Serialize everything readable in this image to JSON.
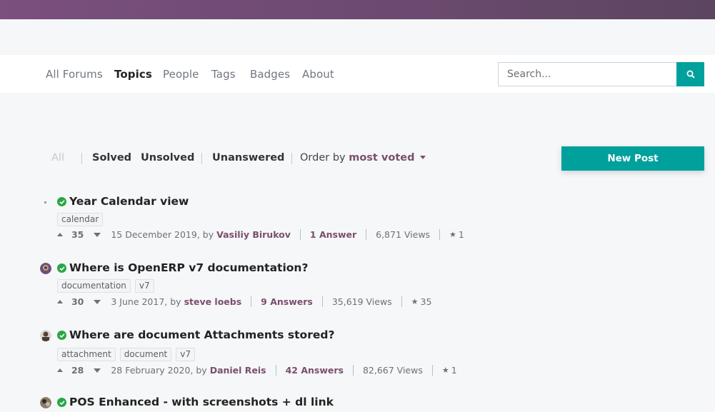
{
  "colors": {
    "topbar": "#7b4f7e",
    "primary": "#00a09d",
    "accent_text": "#7a4f6d",
    "check": "#28a745"
  },
  "nav": {
    "items": [
      {
        "label": "All Forums",
        "active": false
      },
      {
        "label": "Topics",
        "active": true
      },
      {
        "label": "People",
        "active": false
      },
      {
        "label": "Tags",
        "active": false
      },
      {
        "label": "Badges",
        "active": false
      },
      {
        "label": "About",
        "active": false
      }
    ]
  },
  "search": {
    "placeholder": "Search...",
    "icon": "search-icon"
  },
  "filters": {
    "all": "All",
    "solved": "Solved",
    "unsolved": "Unsolved",
    "unanswered": "Unanswered",
    "order_prefix": "Order by",
    "order_value": "most voted"
  },
  "new_post_label": "New Post",
  "posts": [
    {
      "title": "Year Calendar view",
      "tags": [
        "calendar"
      ],
      "votes": "35",
      "date_prefix": "15 December 2019, by",
      "author": "Vasiliy Birukov",
      "answers": "1 Answer",
      "views": "6,871 Views",
      "favorites": "1"
    },
    {
      "title": "Where is OpenERP v7 documentation?",
      "tags": [
        "documentation",
        "v7"
      ],
      "votes": "30",
      "date_prefix": "3 June 2017, by",
      "author": "steve loebs",
      "answers": "9 Answers",
      "views": "35,619 Views",
      "favorites": "35"
    },
    {
      "title": "Where are document Attachments stored?",
      "tags": [
        "attachment",
        "document",
        "v7"
      ],
      "votes": "28",
      "date_prefix": "28 February 2020, by",
      "author": "Daniel Reis",
      "answers": "42 Answers",
      "views": "82,667 Views",
      "favorites": "1"
    },
    {
      "title": "POS Enhanced - with screenshots + dl link"
    }
  ]
}
